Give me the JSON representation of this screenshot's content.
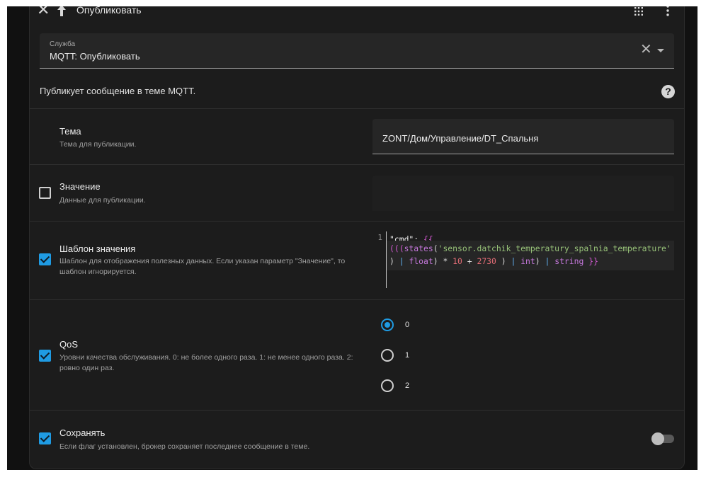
{
  "header": {
    "title": "Опубликовать"
  },
  "service": {
    "label": "Служба",
    "value": "MQTT: Опубликовать"
  },
  "description": "Публикует сообщение в теме MQTT.",
  "fields": {
    "topic": {
      "name": "Тема",
      "description": "Тема для публикации.",
      "value": "ZONT/Дом/Управление/DT_Спальня"
    },
    "payload": {
      "name": "Значение",
      "description": "Данные для публикации.",
      "checked": false,
      "value": ""
    },
    "payload_template": {
      "name": "Шаблон значения",
      "description": "Шаблон для отображения полезных данных. Если указан параметр \"Значение\", то шаблон игнорируется.",
      "checked": true,
      "line_number": "1",
      "code_line1_key": "\"cmd\"",
      "code_line1_colon": ": ",
      "code_line1_open": "{{",
      "code_line2_parens": "(((",
      "code_line2_fn": "states",
      "code_line2_open": "(",
      "code_line2_str": "'sensor.datchik_temperatury_spalnia_temperature'",
      "code_line3_close": ")",
      "code_line3_pipe1": "|",
      "code_line3_filter1": "float",
      "code_line3_close2": ")",
      "code_line3_op1": "*",
      "code_line3_num1": "10",
      "code_line3_op2": "+",
      "code_line3_num2": "2730",
      "code_line3_close3": ")",
      "code_line3_pipe2": "|",
      "code_line3_filter2": "int",
      "code_line3_close4": ")",
      "code_line3_pipe3": "|",
      "code_line3_filter3": "string",
      "code_line3_end": "}}"
    },
    "qos": {
      "name": "QoS",
      "description": "Уровни качества обслуживания. 0: не более одного раза. 1: не менее одного раза. 2: ровно один раз.",
      "checked": true,
      "options": [
        "0",
        "1",
        "2"
      ],
      "selected": "0"
    },
    "retain": {
      "name": "Сохранять",
      "description": "Если флаг установлен, брокер сохраняет последнее сообщение в теме.",
      "checked": true,
      "toggle_on": false
    }
  },
  "colors": {
    "accent": "#1f9be3",
    "card_bg": "#1c1c1c",
    "field_bg": "#262626"
  },
  "icons": [
    "close-icon",
    "arrow-up-icon",
    "grid-icon",
    "more-vert-icon",
    "clear-icon",
    "dropdown-caret-icon",
    "help-icon"
  ]
}
